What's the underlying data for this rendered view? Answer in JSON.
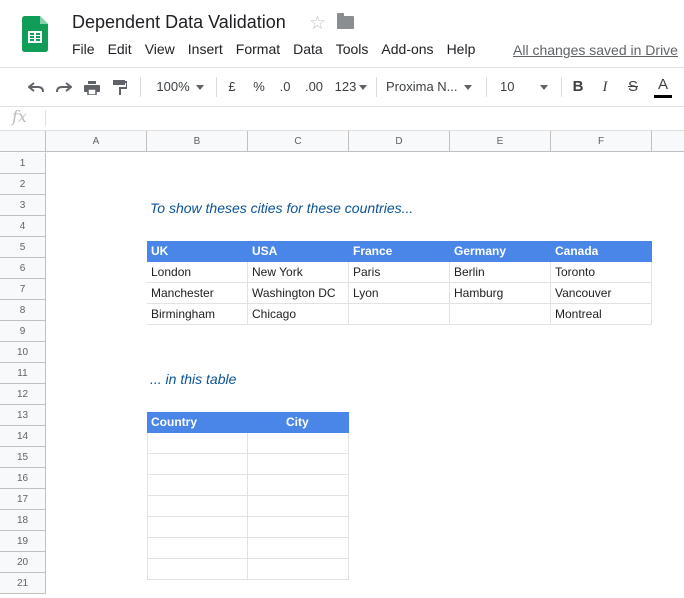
{
  "title": "Dependent Data Validation",
  "menu": [
    "File",
    "Edit",
    "View",
    "Insert",
    "Format",
    "Data",
    "Tools",
    "Add-ons",
    "Help"
  ],
  "save_status": "All changes saved in Drive",
  "toolbar": {
    "zoom": "100%",
    "currency": "£",
    "percent": "%",
    "decrease_decimals": ".0",
    "increase_decimals": ".00",
    "more_formats": "123",
    "font": "Proxima N...",
    "font_size": "10",
    "bold": "B",
    "italic": "I",
    "strikethrough": "S",
    "text_color": "A"
  },
  "formula_bar": {
    "icon": "fx",
    "value": ""
  },
  "columns": [
    "A",
    "B",
    "C",
    "D",
    "E",
    "F"
  ],
  "rows": [
    "1",
    "2",
    "3",
    "4",
    "5",
    "6",
    "7",
    "8",
    "9",
    "10",
    "11",
    "12",
    "13",
    "14",
    "15",
    "16",
    "17",
    "18",
    "19",
    "20",
    "21"
  ],
  "note_top": "To show theses cities for these countries...",
  "cities_table": {
    "headers": [
      "UK",
      "USA",
      "France",
      "Germany",
      "Canada"
    ],
    "rows": [
      [
        "London",
        "New York",
        "Paris",
        "Berlin",
        "Toronto"
      ],
      [
        "Manchester",
        "Washington DC",
        "Lyon",
        "Hamburg",
        "Vancouver"
      ],
      [
        "Birmingham",
        "Chicago",
        "",
        "",
        "Montreal"
      ]
    ]
  },
  "note_bottom": "... in this table",
  "entry_table": {
    "headers": [
      "Country",
      "City"
    ],
    "empty_rows": 7
  },
  "colors": {
    "header_fill": "#4a86e8",
    "note_text": "#0b5394",
    "logo_green": "#0f9d58"
  }
}
